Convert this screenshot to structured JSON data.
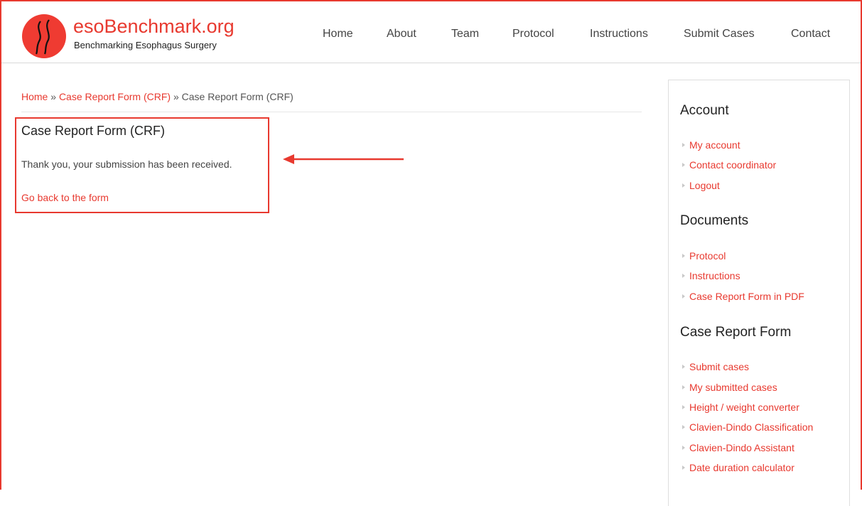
{
  "site": {
    "name": "esoBenchmark.org",
    "slogan": "Benchmarking Esophagus Surgery"
  },
  "nav": {
    "items": [
      "Home",
      "About",
      "Team",
      "Protocol",
      "Instructions",
      "Submit Cases",
      "Contact"
    ]
  },
  "breadcrumb": {
    "home": "Home",
    "sep1": " » ",
    "parent": "Case Report Form (CRF)",
    "sep2": " » ",
    "current": "Case Report Form (CRF)"
  },
  "main": {
    "title": "Case Report Form (CRF)",
    "message": "Thank you, your submission has been received.",
    "back_link": "Go back to the form"
  },
  "sidebar": {
    "account_title": "Account",
    "account_links": [
      "My account",
      "Contact coordinator",
      "Logout"
    ],
    "documents_title": "Documents",
    "documents_links": [
      "Protocol",
      "Instructions",
      "Case Report Form in PDF"
    ],
    "crf_title": "Case Report Form",
    "crf_links": [
      "Submit cases",
      "My submitted cases",
      "Height / weight converter",
      "Clavien-Dindo Classification",
      "Clavien-Dindo Assistant",
      "Date duration calculator"
    ]
  },
  "colors": {
    "accent": "#e8392f",
    "logo": "#ef3b32",
    "text": "#333333",
    "bullet": "#c9c9c9"
  },
  "icons": {
    "logo": "esophagus-logo-icon",
    "annotation": "left-arrow-icon",
    "bullet": "triangle-bullet-icon"
  }
}
